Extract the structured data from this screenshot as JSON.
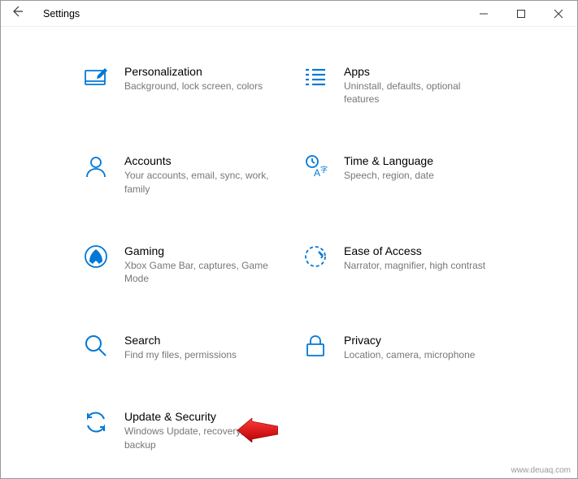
{
  "window": {
    "title": "Settings"
  },
  "items": [
    {
      "title": "Personalization",
      "desc": "Background, lock screen, colors"
    },
    {
      "title": "Apps",
      "desc": "Uninstall, defaults, optional features"
    },
    {
      "title": "Accounts",
      "desc": "Your accounts, email, sync, work, family"
    },
    {
      "title": "Time & Language",
      "desc": "Speech, region, date"
    },
    {
      "title": "Gaming",
      "desc": "Xbox Game Bar, captures, Game Mode"
    },
    {
      "title": "Ease of Access",
      "desc": "Narrator, magnifier, high contrast"
    },
    {
      "title": "Search",
      "desc": "Find my files, permissions"
    },
    {
      "title": "Privacy",
      "desc": "Location, camera, microphone"
    },
    {
      "title": "Update & Security",
      "desc": "Windows Update, recovery, backup"
    }
  ],
  "watermark": "www.deuaq.com"
}
